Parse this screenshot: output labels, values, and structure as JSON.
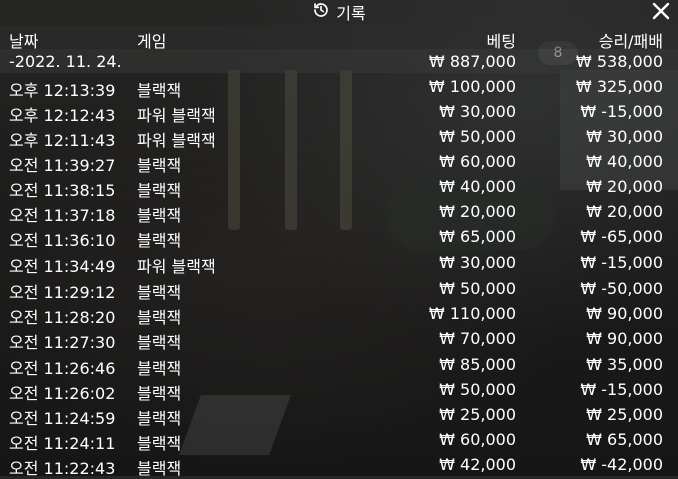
{
  "window": {
    "title": "기록"
  },
  "header": {
    "date_label": "날짜",
    "game_label": "게임",
    "bet_label": "베팅",
    "result_label": "승리/패배"
  },
  "background": {
    "chip_text": "8"
  },
  "summary": {
    "date": "-2022. 11. 24.",
    "bet": "₩ 887,000",
    "result": "₩ 538,000"
  },
  "rows": [
    {
      "time": "오후 12:13:39",
      "game": "블랙잭",
      "bet": "₩ 100,000",
      "result": "₩ 325,000"
    },
    {
      "time": "오후 12:12:43",
      "game": "파워 블랙잭",
      "bet": "₩ 30,000",
      "result": "₩ -15,000"
    },
    {
      "time": "오후 12:11:43",
      "game": "파워 블랙잭",
      "bet": "₩ 50,000",
      "result": "₩ 30,000"
    },
    {
      "time": "오전 11:39:27",
      "game": "블랙잭",
      "bet": "₩ 60,000",
      "result": "₩ 40,000"
    },
    {
      "time": "오전 11:38:15",
      "game": "블랙잭",
      "bet": "₩ 40,000",
      "result": "₩ 20,000"
    },
    {
      "time": "오전 11:37:18",
      "game": "블랙잭",
      "bet": "₩ 20,000",
      "result": "₩ 20,000"
    },
    {
      "time": "오전 11:36:10",
      "game": "블랙잭",
      "bet": "₩ 65,000",
      "result": "₩ -65,000"
    },
    {
      "time": "오전 11:34:49",
      "game": "파워 블랙잭",
      "bet": "₩ 30,000",
      "result": "₩ -15,000"
    },
    {
      "time": "오전 11:29:12",
      "game": "블랙잭",
      "bet": "₩ 50,000",
      "result": "₩ -50,000"
    },
    {
      "time": "오전 11:28:20",
      "game": "블랙잭",
      "bet": "₩ 110,000",
      "result": "₩ 90,000"
    },
    {
      "time": "오전 11:27:30",
      "game": "블랙잭",
      "bet": "₩ 70,000",
      "result": "₩ 90,000"
    },
    {
      "time": "오전 11:26:46",
      "game": "블랙잭",
      "bet": "₩ 85,000",
      "result": "₩ 35,000"
    },
    {
      "time": "오전 11:26:02",
      "game": "블랙잭",
      "bet": "₩ 50,000",
      "result": "₩ -15,000"
    },
    {
      "time": "오전 11:24:59",
      "game": "블랙잭",
      "bet": "₩ 25,000",
      "result": "₩ 25,000"
    },
    {
      "time": "오전 11:24:11",
      "game": "블랙잭",
      "bet": "₩ 60,000",
      "result": "₩ 65,000"
    },
    {
      "time": "오전 11:22:43",
      "game": "블랙잭",
      "bet": "₩ 42,000",
      "result": "₩ -42,000"
    }
  ],
  "icons": {
    "title": "history-icon",
    "close": "close-icon"
  },
  "colors": {
    "text": "#ffffff"
  }
}
